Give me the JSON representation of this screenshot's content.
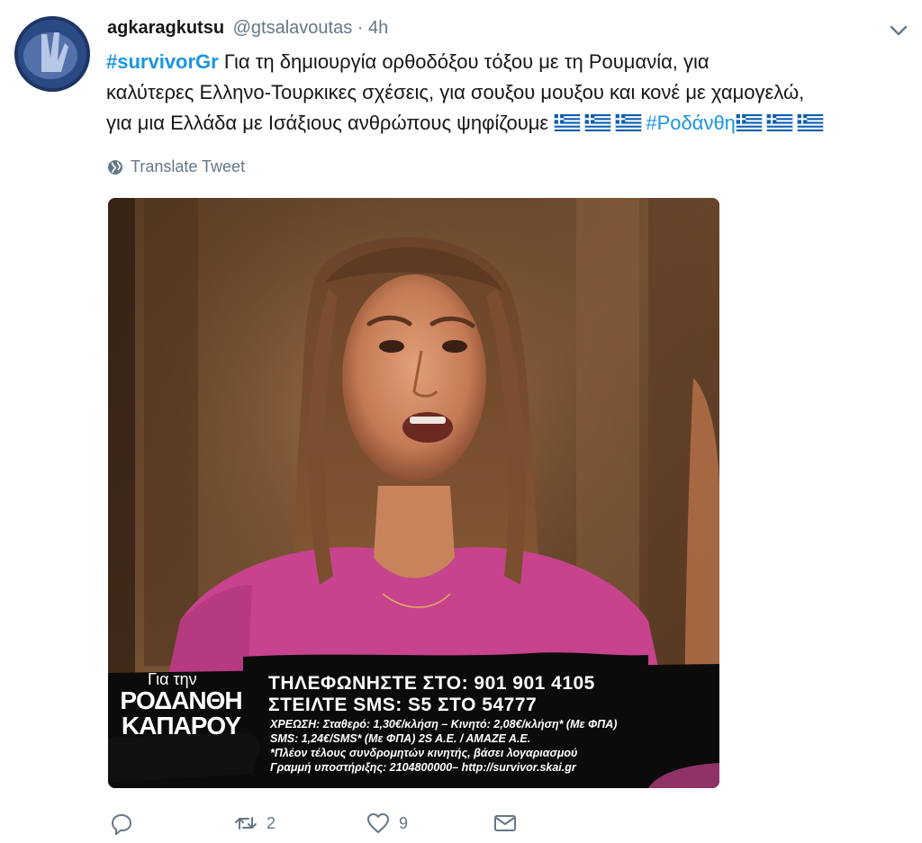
{
  "tweet": {
    "display_name": "agkaragkutsu",
    "handle": "@gtsalavoutas",
    "separator": "·",
    "time": "4h",
    "text_parts": {
      "hashtag_survivor": "#survivorGr",
      "line1": " Για τη δημιουργία ορθοδόξου τόξου με τη Ρουμανία, για",
      "line2": "καλύτερες Ελληνο-Τουρκικες σχέσεις, για σουξου μουξου και κονέ με χαμογελώ,",
      "line3": "για μια Ελλάδα με Ισάξιους ανθρώπους ψηφίζουμε ",
      "hashtag_rodanthi": "#Ροδάνθη"
    },
    "translate_label": "Translate Tweet",
    "media": {
      "overlay": {
        "for_label": "Για την",
        "candidate_first": "ΡΟΔΑΝΘΗ",
        "candidate_last": "ΚΑΠΑΡΟΥ",
        "call": "ΤΗΛΕΦΩΝΗΣΤΕ ΣΤΟ: 901 901 4105",
        "sms": "ΣΤΕΙΛΤΕ SMS: S5 ΣΤΟ 54777",
        "fine1": "ΧΡΕΩΣΗ: Σταθερό: 1,30€/κλήση – Κινητό: 2,08€/κλήση* (Με ΦΠΑ)",
        "fine2": "SMS: 1,24€/SMS* (Με ΦΠΑ) 2S A.E. / AMAZE A.E.",
        "fine3": "*Πλέον τέλους συνδρομητών κινητής, βάσει λογαριασμού",
        "fine4": "Γραμμή υποστήριξης: 2104800000–  http://survivor.skai.gr"
      }
    },
    "actions": {
      "reply_count": "",
      "retweet_count": "2",
      "like_count": "9"
    }
  },
  "colors": {
    "link": "#1b95e0",
    "secondary": "#657786",
    "text": "#14171a"
  },
  "icons": [
    "avatar",
    "caret-down-icon",
    "greek-flag-icon",
    "globe-icon",
    "reply-icon",
    "retweet-icon",
    "like-icon",
    "message-icon"
  ]
}
